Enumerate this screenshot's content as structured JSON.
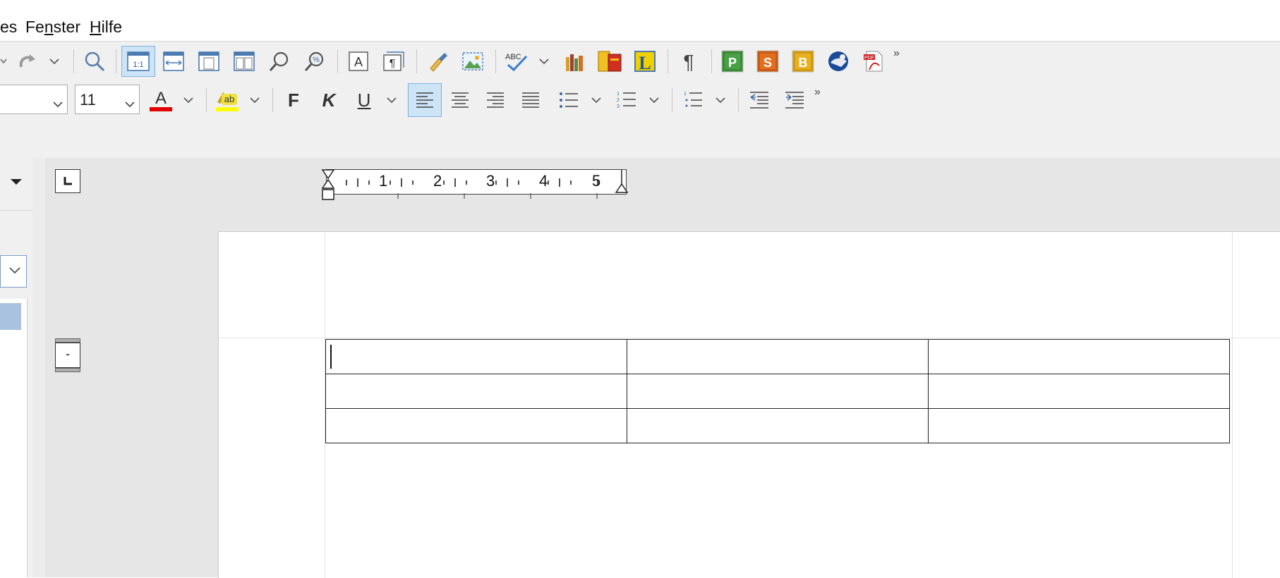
{
  "menu": {
    "items": [
      {
        "label": "es",
        "accel": ""
      },
      {
        "label": "Fenster",
        "accel": "n"
      },
      {
        "label": "Hilfe",
        "accel": "H"
      }
    ]
  },
  "format_toolbar": {
    "font_size": "11",
    "bold_label": "F",
    "italic_label": "K",
    "underline_label": "U",
    "font_color": "#e00000",
    "highlight_color": "#ffff00"
  },
  "ruler": {
    "numbers": [
      "1",
      "2",
      "3",
      "4",
      "5"
    ]
  },
  "vruler_marker": "-",
  "table": {
    "rows": [
      [
        "",
        "",
        ""
      ],
      [
        "",
        "",
        ""
      ],
      [
        "",
        "",
        ""
      ]
    ]
  },
  "icons": {
    "toolbar1": [
      "redo-icon",
      "find-icon",
      "zoom-100-icon",
      "page-width-icon",
      "single-page-icon",
      "multi-page-icon",
      "find-replace-icon",
      "zoom-icon",
      "text-box-icon",
      "paragraph-box-icon",
      "clone-format-icon",
      "insert-image-icon",
      "spellcheck-icon",
      "library-icon",
      "dictionary-icon",
      "langenscheidt-icon",
      "formatting-marks-icon",
      "app-p-icon",
      "app-s-icon",
      "app-b-icon",
      "thunderbird-icon",
      "pdf-export-icon"
    ]
  }
}
